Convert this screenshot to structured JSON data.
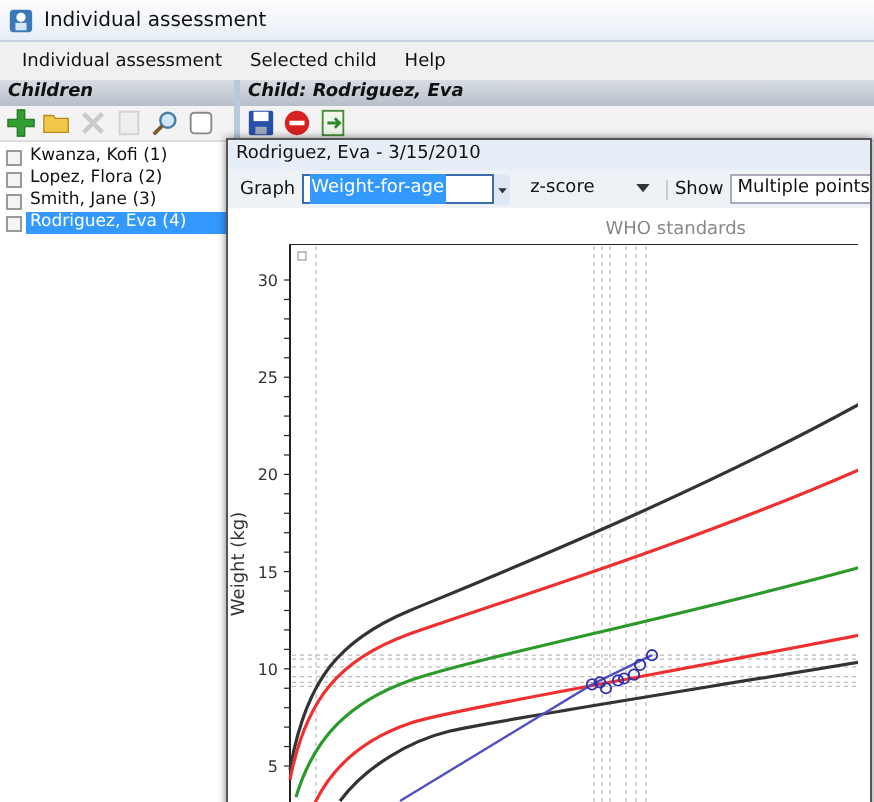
{
  "window": {
    "title": "Individual assessment"
  },
  "menu": [
    "Individual assessment",
    "Selected child",
    "Help"
  ],
  "children_panel": {
    "title": "Children",
    "tools": [
      {
        "kind": "add",
        "disabled": false
      },
      {
        "kind": "open",
        "disabled": false
      },
      {
        "kind": "delete",
        "disabled": true
      },
      {
        "kind": "page",
        "disabled": true
      },
      {
        "kind": "search",
        "disabled": false
      },
      {
        "kind": "blank",
        "disabled": false
      }
    ],
    "items": [
      {
        "label": "Kwanza, Kofi (1)",
        "checked": false,
        "selected": false
      },
      {
        "label": "Lopez, Flora (2)",
        "checked": false,
        "selected": false
      },
      {
        "label": "Smith, Jane (3)",
        "checked": false,
        "selected": false
      },
      {
        "label": "Rodriguez, Eva (4)",
        "checked": false,
        "selected": true
      }
    ]
  },
  "child_panel": {
    "title": "Child: Rodriguez, Eva",
    "tools": [
      {
        "kind": "save",
        "disabled": false
      },
      {
        "kind": "stop",
        "disabled": false
      },
      {
        "kind": "export",
        "disabled": false
      }
    ]
  },
  "dialog": {
    "title": "Rodriguez, Eva - 3/15/2010",
    "graph_label": "Graph",
    "graph_value": "Weight-for-age",
    "scale_value": "z-score",
    "show_label": "Show",
    "show_value": "Multiple points",
    "chart_title": "WHO standards",
    "ylabel": "Weight (kg)",
    "yticks": [
      "30",
      "25",
      "20",
      "15",
      "10",
      "5"
    ]
  }
}
